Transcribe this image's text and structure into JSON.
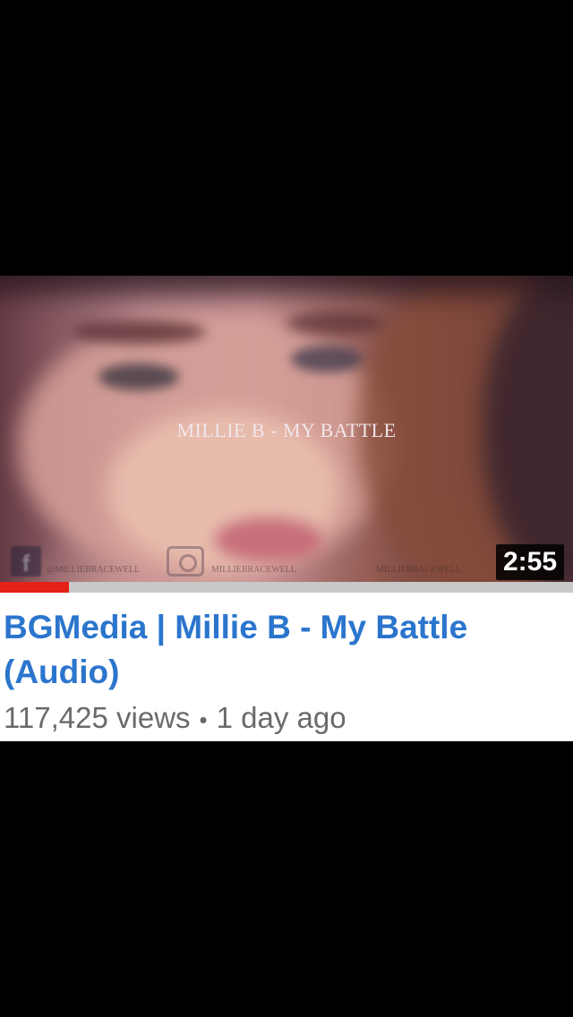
{
  "video": {
    "thumbnail_title": "MILLIE B - MY BATTLE",
    "social_handles": [
      "@MILLIEBRACEWELL",
      "MILLIEBRACEWELL",
      "MILLIEBRACEWELL"
    ],
    "duration": "2:55",
    "progress_fraction": 0.12,
    "title": "BGMedia | Millie B - My Battle (Audio)",
    "views": "117,425 views",
    "separator": "•",
    "age": "1 day ago"
  },
  "colors": {
    "title": "#2b75cd",
    "progress_fill": "#e62117",
    "progress_track": "#c8c8c8",
    "meta": "#6a6a6a"
  }
}
